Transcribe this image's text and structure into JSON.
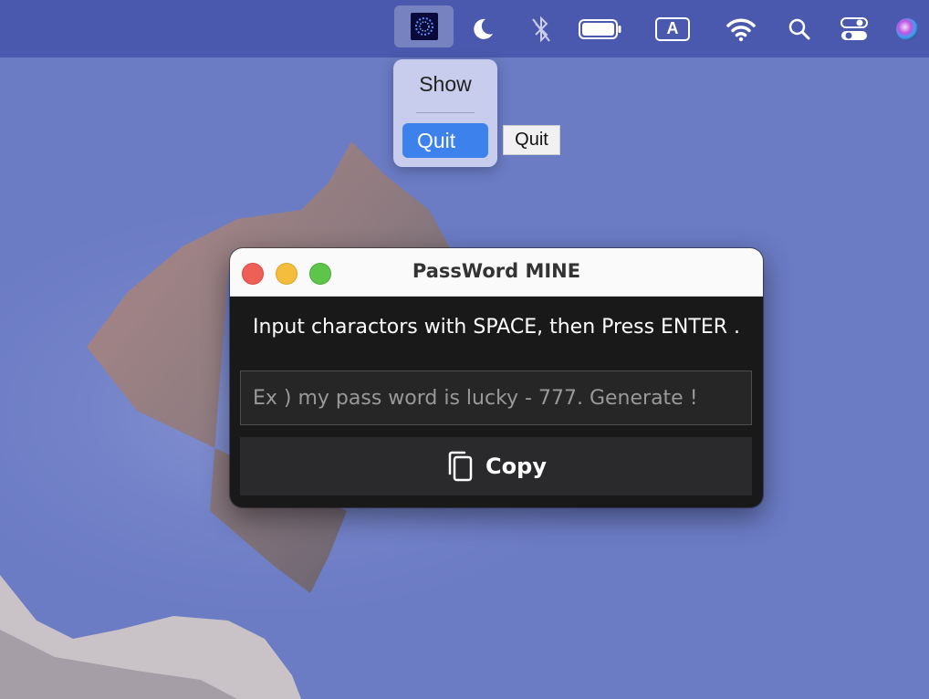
{
  "menubar": {
    "app_icon": "password-mine-app-icon",
    "icons": [
      "moon-icon",
      "bluetooth-off-icon",
      "battery-icon",
      "input-source-A-icon",
      "wifi-icon",
      "search-icon",
      "control-center-icon",
      "siri-icon"
    ],
    "input_source_label": "A"
  },
  "menu": {
    "show_label": "Show",
    "quit_label": "Quit",
    "tooltip": "Quit",
    "accent": "#3d82ec"
  },
  "window": {
    "title": "PassWord MINE",
    "instruction": "Input charactors with SPACE, then Press ENTER .",
    "input_placeholder": "Ex )  my pass word is lucky - 777. Generate !",
    "copy_label": "Copy",
    "copy_icon": "copy-icon"
  }
}
